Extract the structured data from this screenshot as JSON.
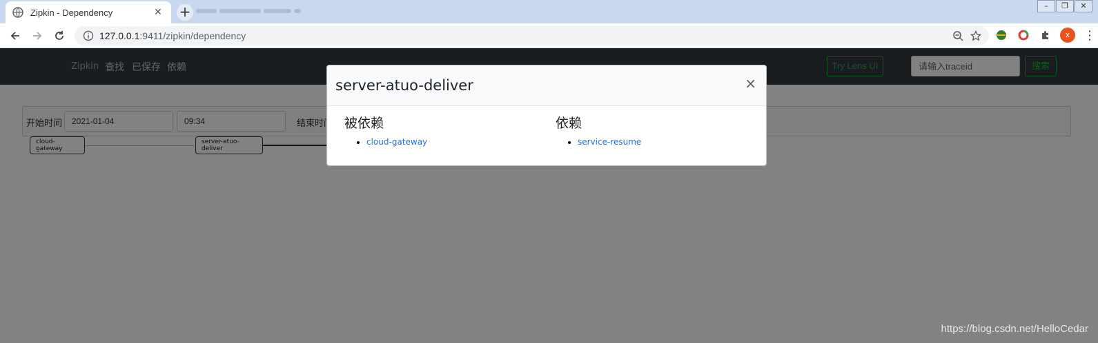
{
  "browser": {
    "tab_title": "Zipkin - Dependency",
    "tab_close": "✕",
    "new_tab": "+",
    "url_host": "127.0.0.1",
    "url_rest": ":9411/zipkin/dependency",
    "avatar_letter": "x",
    "menu": "⋮",
    "win_minimize": "–",
    "win_restore": "❐",
    "win_close": "✕"
  },
  "navbar": {
    "brand": "Zipkin",
    "links": [
      "查找",
      "已保存",
      "依赖"
    ],
    "lens_button": "Try Lens UI",
    "trace_placeholder": "请输入traceid",
    "search_button": "搜索"
  },
  "filter": {
    "start_label": "开始时间",
    "start_date": "2021-01-04",
    "start_time": "09:34",
    "end_label": "结束时间"
  },
  "graph": {
    "nodes": [
      "cloud-gateway",
      "server-atuo-deliver"
    ]
  },
  "modal": {
    "title": "server-atuo-deliver",
    "close": "×",
    "dependents_heading": "被依赖",
    "dependents": [
      "cloud-gateway"
    ],
    "dependencies_heading": "依赖",
    "dependencies": [
      "service-resume"
    ]
  },
  "watermark": "https://blog.csdn.net/HelloCedar",
  "colors": {
    "navbar": "#343a40",
    "accent_green": "#28a745",
    "link_blue": "#1a73e8"
  }
}
